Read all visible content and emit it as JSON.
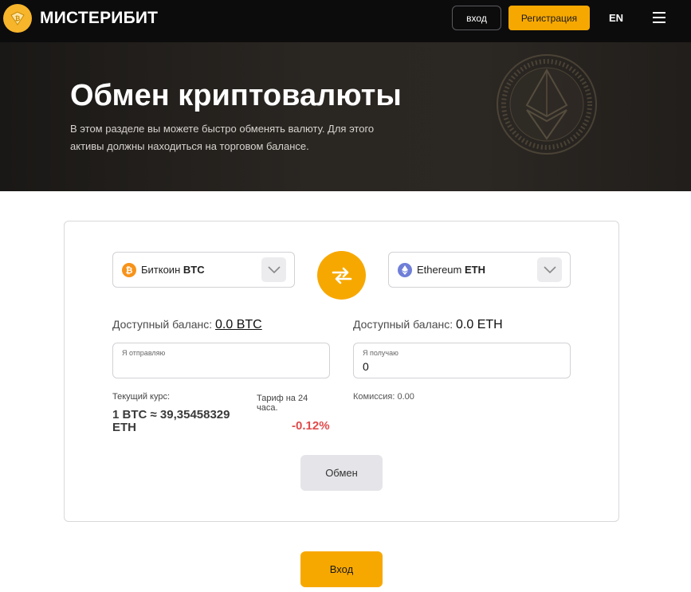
{
  "header": {
    "logo_text": "МИСТЕРИБИТ",
    "login_label": "вход",
    "register_label": "Регистрация",
    "language": "EN"
  },
  "hero": {
    "title": "Обмен криптовалюты",
    "subtitle": "В этом разделе вы можете быстро обменять валюту. Для этого активы должны находиться на торговом балансе."
  },
  "exchange": {
    "from": {
      "name": "Биткоин",
      "ticker": "BTC",
      "icon": "bitcoin-icon"
    },
    "to": {
      "name": "Ethereum",
      "ticker": "ETH",
      "icon": "ethereum-icon"
    },
    "from_balance_label": "Доступный баланс:",
    "from_balance_value": "0.0 BTC",
    "to_balance_label": "Доступный баланс:",
    "to_balance_value": "0.0 ETH",
    "send_label": "Я отправляю",
    "send_value": "",
    "receive_label": "Я получаю",
    "receive_value": "0",
    "rate_label": "Текущий курс:",
    "rate_value": "1 BTC ≈ 39,35458329 ETH",
    "tariff_label": "Тариф на 24 часа.",
    "tariff_value": "-0.12%",
    "commission": "Комиссия: 0.00",
    "exchange_button": "Обмен"
  },
  "footer": {
    "login_button": "Вход"
  },
  "colors": {
    "accent": "#f7a800",
    "header_bg": "#0c0c0d",
    "negative": "#e04b4b"
  }
}
